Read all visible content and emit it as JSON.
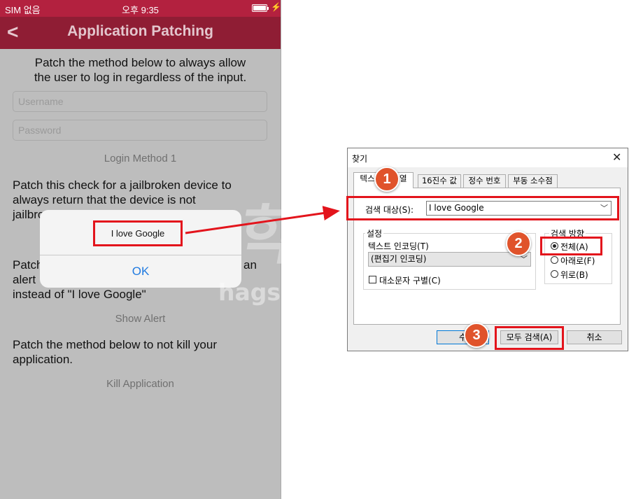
{
  "phone": {
    "status": {
      "carrier": "SIM 없음",
      "time": "오후 9:35",
      "battery_icon": "battery-icon",
      "charging_icon": "lightning-icon"
    },
    "nav": {
      "back_icon": "chevron-left-icon",
      "title": "Application Patching"
    },
    "section1": {
      "line1": "Patch the method below to always allow",
      "line2": "the user to log in regardless of the input."
    },
    "username_placeholder": "Username",
    "password_placeholder": "Password",
    "login_button": "Login Method 1",
    "section2": {
      "line1": "Patch this check for a jailbroken device to",
      "line2": "always return that the device is not",
      "line3": "jailbro"
    },
    "section3": {
      "line1a": "Patch",
      "line1b": "an",
      "line2": "alert",
      "line3": "instead of \"I love Google\""
    },
    "show_alert_button": "Show Alert",
    "section4": {
      "line1": "Patch the method below to not kill your",
      "line2": "application."
    },
    "kill_button": "Kill Application",
    "alert": {
      "message": "I love Google",
      "ok": "OK"
    },
    "colors": {
      "statusbar": "#b3213f",
      "navbar": "#8f1d34",
      "ok_blue": "#1f7ae0"
    }
  },
  "watermark": {
    "big": "학식",
    "url": "hagsig.tistory.com"
  },
  "dialog": {
    "title": "찾기",
    "close": "✕",
    "tabs": [
      "텍스트 문자열",
      "16진수 값",
      "정수 번호",
      "부동 소수점"
    ],
    "search_target_label": "검색 대상(S):",
    "search_value": "I love Google",
    "settings_label": "설정",
    "encoding_label": "텍스트 인코딩(T)",
    "encoding_value": "(편집기 인코딩)",
    "case_label": "대소문자 구별(C)",
    "direction_label": "검색 방향",
    "directions": [
      "전체(A)",
      "아래로(F)",
      "위로(B)"
    ],
    "buttons": {
      "search": "수",
      "find_all": "모두 검색(A)",
      "cancel": "취소"
    }
  },
  "badges": [
    "1",
    "2",
    "3"
  ],
  "highlight_color": "#e3141c"
}
